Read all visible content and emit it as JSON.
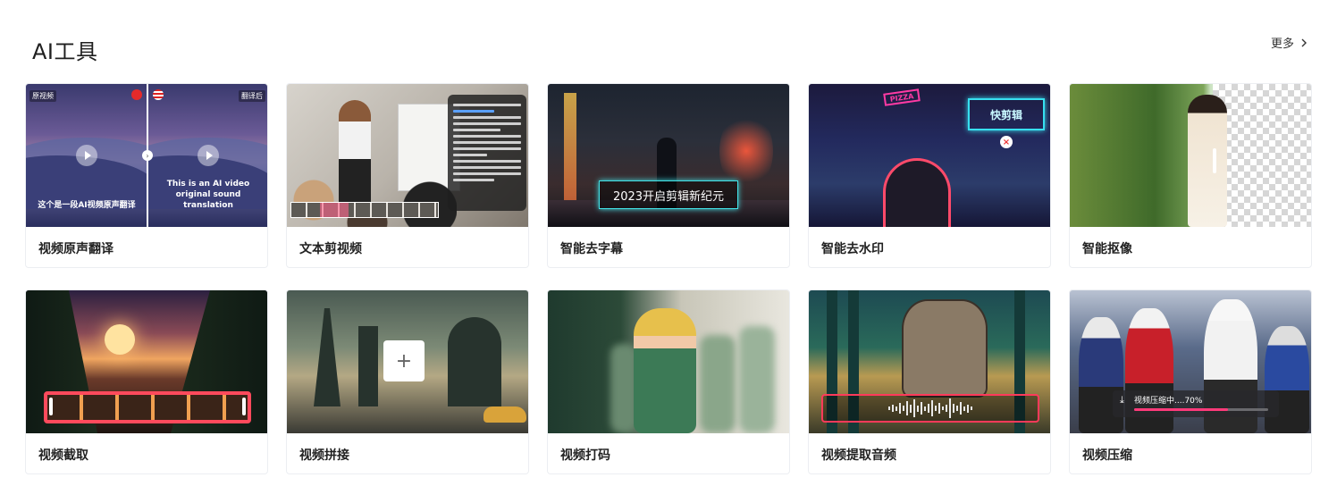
{
  "section": {
    "title": "AI工具",
    "more_label": "更多"
  },
  "tools": [
    {
      "label": "视频原声翻译",
      "thumb": {
        "tag_left": "原视频",
        "tag_right": "翻译后",
        "caption_left": "这个是一段AI视频原声翻译",
        "caption_right": "This is an AI video original sound translation"
      }
    },
    {
      "label": "文本剪视频"
    },
    {
      "label": "智能去字幕",
      "thumb": {
        "subtitle": "2023开启剪辑新纪元"
      }
    },
    {
      "label": "智能去水印",
      "thumb": {
        "neon_sign": "PIZZA",
        "watermark": "快剪辑"
      }
    },
    {
      "label": "智能抠像"
    },
    {
      "label": "视频截取"
    },
    {
      "label": "视频拼接"
    },
    {
      "label": "视频打码"
    },
    {
      "label": "视频提取音频"
    },
    {
      "label": "视频压缩",
      "thumb": {
        "progress_text": "视频压缩中....70%",
        "progress": 0.7
      }
    }
  ],
  "colors": {
    "accent_pink": "#ff3a7a",
    "neon_cyan": "#42e3e8",
    "trim_red": "#ff4a5c"
  }
}
